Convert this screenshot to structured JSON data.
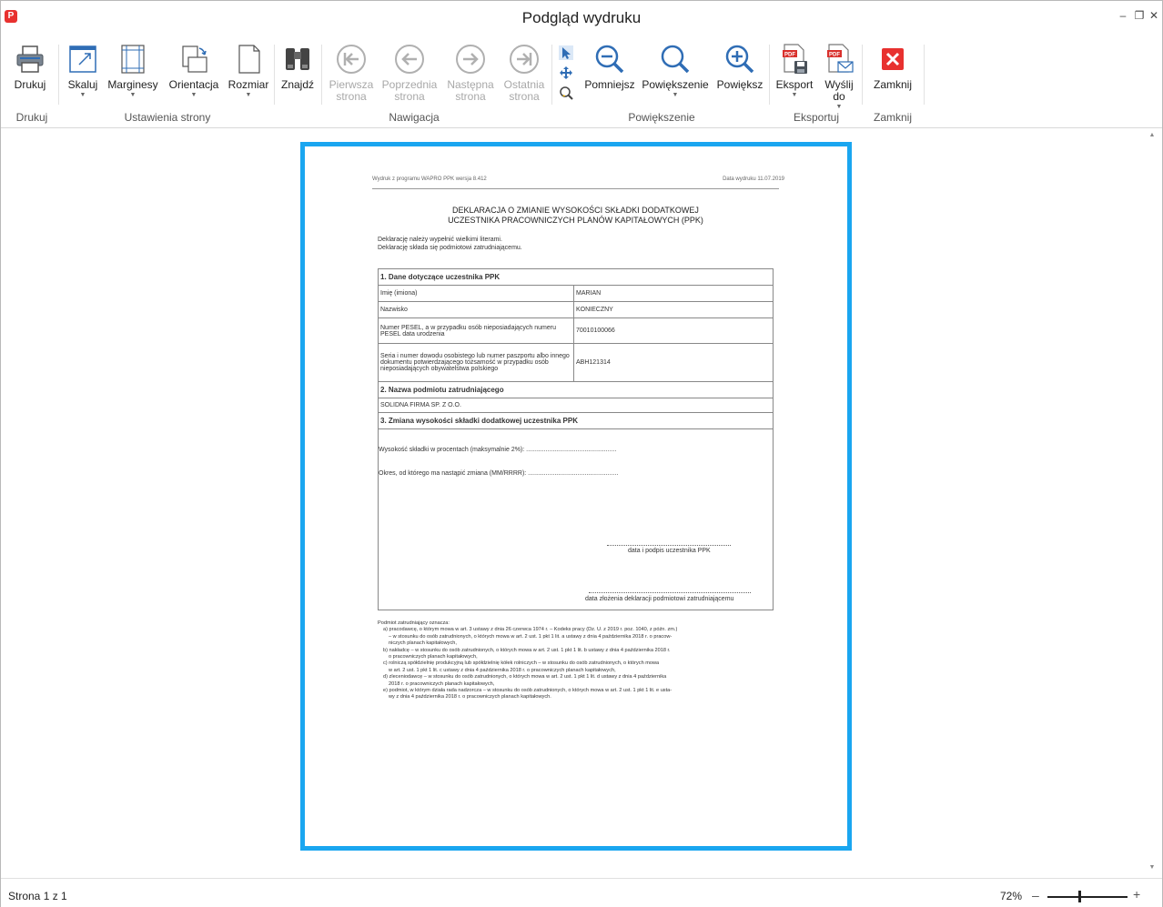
{
  "window": {
    "title": "Podgląd wydruku"
  },
  "toolbar": {
    "print_label": "Drukuj",
    "scale_label": "Skaluj",
    "margins_label": "Marginesy",
    "orientation_label": "Orientacja",
    "size_label": "Rozmiar",
    "find_label": "Znajdź",
    "first_label": "Pierwsza strona",
    "prev_label": "Poprzednia strona",
    "next_label": "Następna strona",
    "last_label": "Ostatnia strona",
    "zoom_out_label": "Pomniejsz",
    "magnify_label": "Powiększenie",
    "zoom_in_label": "Powiększ",
    "export_label": "Eksport",
    "send_label": "Wyślij do",
    "close_label": "Zamknij"
  },
  "groups": {
    "print": "Drukuj",
    "page_setup": "Ustawienia strony",
    "navigation": "Nawigacja",
    "zoom": "Powiększenie",
    "export": "Eksportuj",
    "close": "Zamknij"
  },
  "document": {
    "header_left": "Wydruk z programu WAPRO PPK wersja 8.412",
    "header_right": "Data wydruku 11.07.2019",
    "title_line1": "DEKLARACJA O ZMIANIE WYSOKOŚCI SKŁADKI DODATKOWEJ",
    "title_line2": "UCZESTNIKA PRACOWNICZYCH PLANÓW KAPITAŁOWYCH (PPK)",
    "intro_line1": "Deklarację należy wypełnić wielkimi literami.",
    "intro_line2": "Deklarację składa się podmiotowi zatrudniającemu.",
    "section1": "1. Dane dotyczące uczestnika PPK",
    "rows": [
      {
        "label": "Imię (imiona)",
        "value": "MARIAN"
      },
      {
        "label": "Nazwisko",
        "value": "KONIECZNY"
      },
      {
        "label": "Numer PESEL, a w przypadku osób nieposiadających numeru PESEL data urodzenia",
        "value": "70010100066"
      },
      {
        "label": "Seria i numer dowodu osobistego lub numer paszportu albo innego dokumentu potwierdzającego tożsamość w przypadku osób nieposiadających obywatelstwa polskiego",
        "value": "ABH121314"
      }
    ],
    "section2": "2. Nazwa podmiotu zatrudniającego",
    "employer": "SOLIDNA FIRMA SP. Z O.O.",
    "section3": "3. Zmiana wysokości składki dodatkowej uczestnika PPK",
    "contribution_line": "Wysokość składki w procentach (maksymalnie 2%):  ...................................................",
    "period_line": "Okres, od którego ma nastąpić zmiana (MM/RRRR): ...................................................",
    "signature_participant": "data i podpis uczestnika PPK",
    "signature_employer": "data złożenia deklaracji podmiotowi zatrudniającemu",
    "footnotes": {
      "intro": "Podmiot zatrudniający oznacza:",
      "a": "a) pracodawcę, o którym mowa w art. 3 ustawy z dnia 26 czerwca 1974 r. – Kodeks pracy (Dz. U. z 2019 r. poz. 1040, z późn. zm.)",
      "a2": "– w stosunku do osób zatrudnionych, o których mowa w art. 2 ust. 1 pkt 1 lit. a ustawy z dnia 4 października 2018 r. o pracow-",
      "a3": "niczych planach kapitałowych,",
      "b": "b) nakładcę – w stosunku do osób zatrudnionych, o których mowa w art. 2 ust. 1 pkt 1 lit. b ustawy z dnia 4 października 2018 r.",
      "b2": "o pracowniczych planach kapitałowych,",
      "c": "c) rolniczą spółdzielnię produkcyjną lub spółdzielnię kółek rolniczych – w stosunku do osób zatrudnionych, o których mowa",
      "c2": "w art. 2 ust. 1 pkt 1 lit. c ustawy z dnia 4 października 2018 r. o pracowniczych planach kapitałowych,",
      "d": "d) zleceniodawcę – w stosunku do osób zatrudnionych, o których mowa w art. 2 ust. 1 pkt 1 lit. d ustawy z dnia 4 października",
      "d2": "2018 r. o pracowniczych planach kapitałowych,",
      "e": "e) podmiot, w którym działa rada nadzorcza – w stosunku do osób zatrudnionych, o których mowa w art. 2 ust. 1 pkt 1 lit. e usta-",
      "e2": "wy z dnia 4 października 2018 r. o pracowniczych planach kapitałowych."
    }
  },
  "statusbar": {
    "page_info": "Strona 1 z 1",
    "zoom": "72%",
    "zoom_level_percent": 72
  },
  "colors": {
    "page_border": "#1aa6f0",
    "close_red": "#e8312f",
    "icon_blue": "#2f6db5"
  }
}
